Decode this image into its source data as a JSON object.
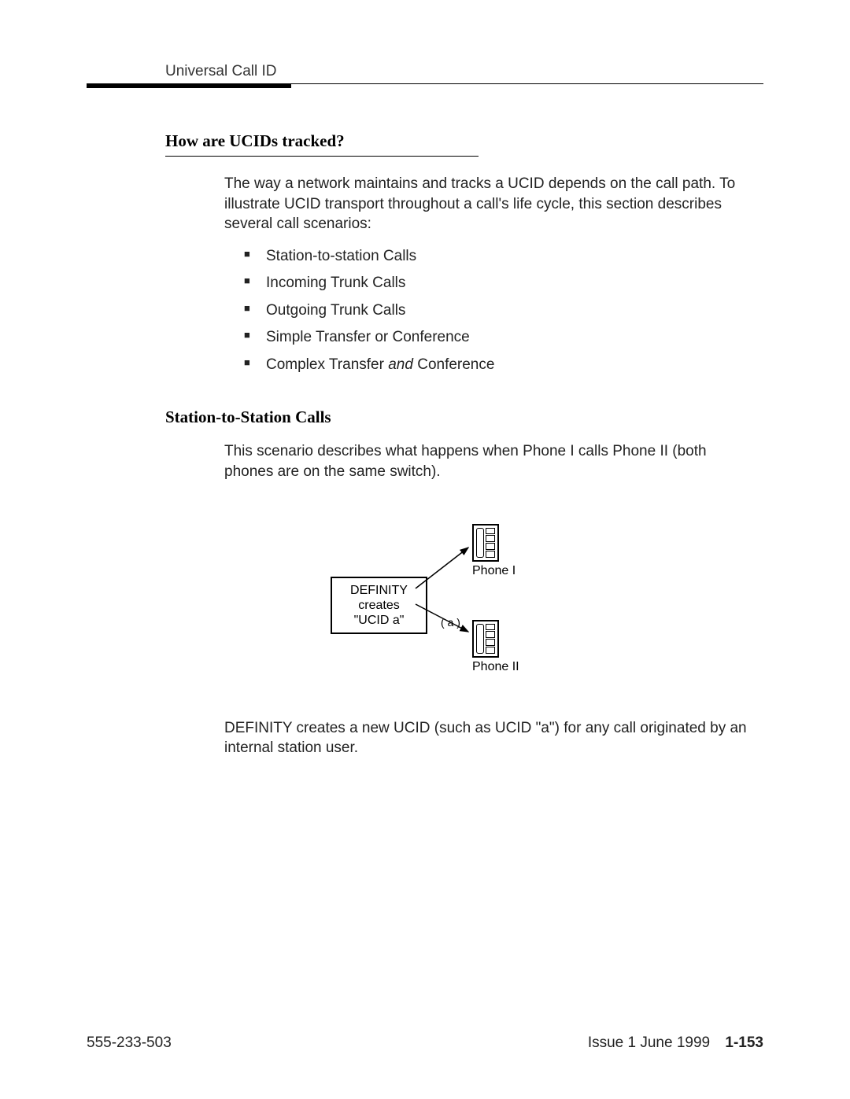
{
  "header": {
    "running_title": "Universal Call ID"
  },
  "section1": {
    "heading": "How are UCIDs tracked?",
    "intro": "The way a network maintains and tracks a UCID depends on the call path. To illustrate UCID transport throughout a call's life cycle, this section describes several call scenarios:",
    "bullets": {
      "b0": "Station-to-station Calls",
      "b1": "Incoming Trunk Calls",
      "b2": "Outgoing Trunk Calls",
      "b3": "Simple Transfer or Conference",
      "b4_pre": "Complex Transfer ",
      "b4_em": "and",
      "b4_post": " Conference"
    }
  },
  "section2": {
    "heading": "Station-to-Station Calls",
    "intro": "This scenario describes what happens when Phone I calls Phone II (both phones are on the same switch).",
    "closing": "DEFINITY creates a new UCID (such as UCID \"a\") for any call originated by an internal station user."
  },
  "figure": {
    "box_line1": "DEFINITY",
    "box_line2": "creates",
    "box_line3": "\"UCID a\"",
    "phone1_label": "Phone I",
    "phone2_label": "Phone II",
    "edge_label": "a"
  },
  "footer": {
    "doc_number": "555-233-503",
    "issue": "Issue 1 June 1999",
    "page": "1-153"
  }
}
